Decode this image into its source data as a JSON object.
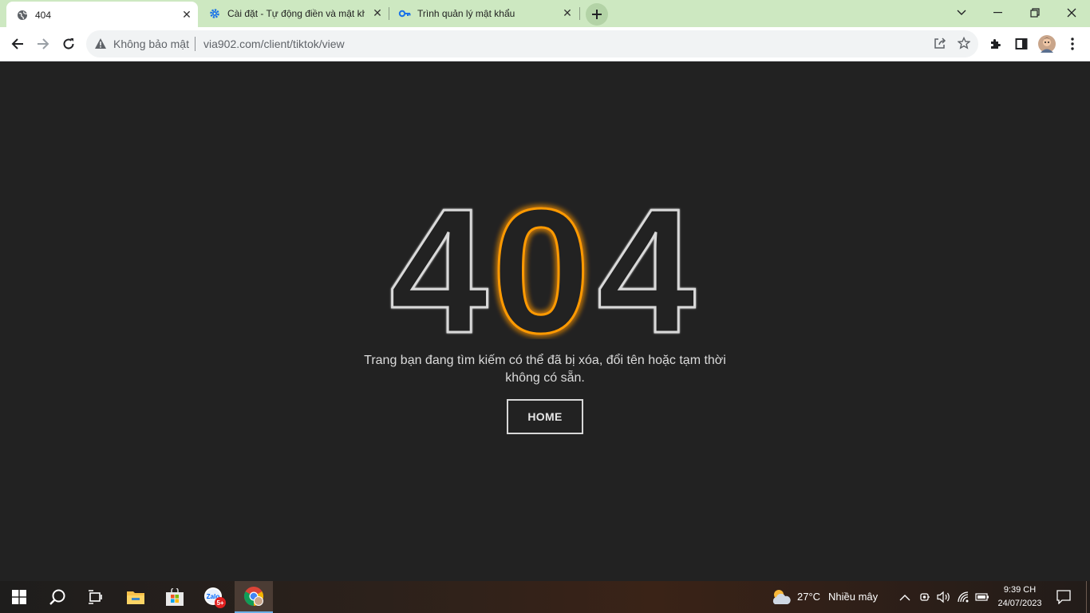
{
  "browser": {
    "tabs": [
      {
        "title": "404",
        "active": true
      },
      {
        "title": "Cài đặt - Tự động điền và mật khẩu",
        "active": false
      },
      {
        "title": "Trình quản lý mật khẩu",
        "active": false
      }
    ],
    "omnibox": {
      "security_label": "Không bảo mật",
      "url": "via902.com/client/tiktok/view"
    }
  },
  "page": {
    "error_code": "404",
    "message_line1": "Trang bạn đang tìm kiếm có thể đã bị xóa, đổi tên hoặc tạm thời",
    "message_line2": "không có sẵn.",
    "home_button": "HOME"
  },
  "taskbar": {
    "weather_temp": "27°C",
    "weather_desc": "Nhiều mây",
    "time": "9:39 CH",
    "date": "24/07/2023",
    "zalo_badge": "5+"
  },
  "colors": {
    "page_bg": "#222222",
    "tabstrip_bg": "#cde8c1",
    "glow_orange": "#ff9a00",
    "outline_white": "#d9d9d9"
  }
}
